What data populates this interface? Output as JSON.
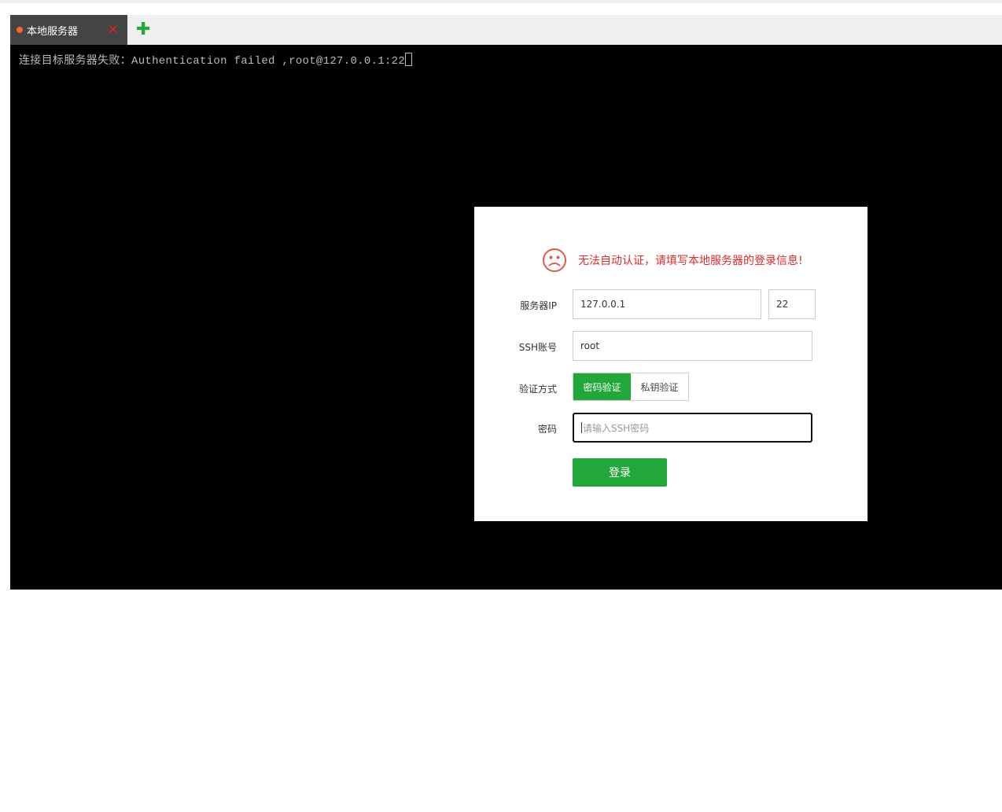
{
  "tabs": [
    {
      "label": "本地服务器",
      "status_color": "#f5652d",
      "active": true
    }
  ],
  "add_tab_icon": "plus-icon",
  "close_tab_icon": "close-icon",
  "terminal": {
    "output": "连接目标服务器失败：Authentication failed ,root@127.0.0.1:22"
  },
  "dialog": {
    "message": "无法自动认证，请填写本地服务器的登录信息!",
    "message_icon": "sad-face-icon",
    "server_ip_label": "服务器IP",
    "server_ip": "127.0.0.1",
    "port": "22",
    "ssh_account_label": "SSH账号",
    "ssh_account": "root",
    "auth_method_label": "验证方式",
    "auth_methods": [
      "密码验证",
      "私钥验证"
    ],
    "auth_method_selected": "密码验证",
    "password_label": "密码",
    "password_placeholder": "请输入SSH密码",
    "login_label": "登录"
  },
  "colors": {
    "accent": "#22a83a",
    "error": "#e02a2a"
  }
}
